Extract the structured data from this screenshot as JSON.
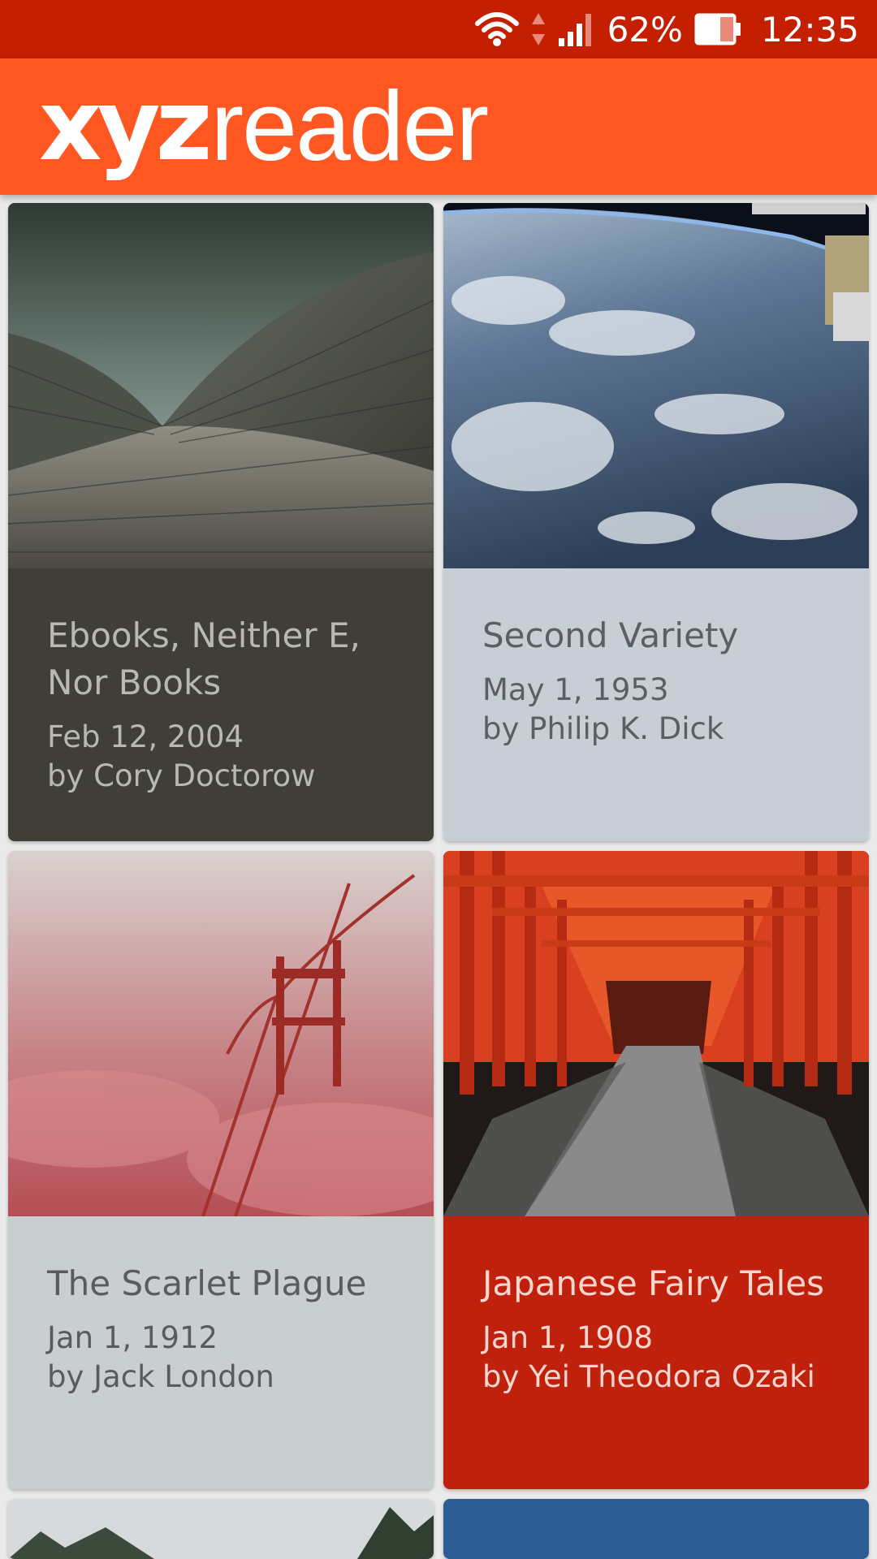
{
  "status_bar": {
    "battery_percent": "62%",
    "time": "12:35",
    "icons": [
      "wifi-icon",
      "data-arrows-icon",
      "signal-icon",
      "battery-icon"
    ],
    "color": "#c41f00"
  },
  "app_bar": {
    "logo_bold": "xyz",
    "logo_light": "reader",
    "color": "#ff5722"
  },
  "articles": [
    {
      "title": "Ebooks, Neither E, Nor Books",
      "date": "Feb 12, 2004",
      "author": "by Cory Doctorow",
      "image": "opera-house-roof-image",
      "meta_bg": "#3f3f38",
      "text_color": "#b9b9b2"
    },
    {
      "title": "Second Variety",
      "date": "May 1, 1953",
      "author": "by Philip K. Dick",
      "image": "earth-from-space-image",
      "meta_bg": "#c8ced6",
      "text_color": "#5b5f64"
    },
    {
      "title": "The Scarlet Plague",
      "date": "Jan 1, 1912",
      "author": "by Jack London",
      "image": "bridge-in-red-fog-image",
      "meta_bg": "#c9cecf",
      "text_color": "#595c5e"
    },
    {
      "title": "Japanese Fairy Tales",
      "date": "Jan 1, 1908",
      "author": "by Yei Theodora Ozaki",
      "image": "torii-gates-tunnel-image",
      "meta_bg": "#c0210c",
      "text_color": "#f6d6cf"
    }
  ]
}
